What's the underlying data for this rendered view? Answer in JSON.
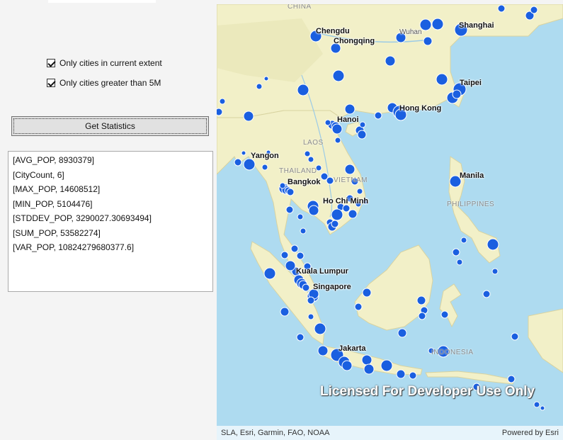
{
  "options": {
    "extent_label": "Only cities in current extent",
    "extent_checked": true,
    "pop_label": "Only cities greater than 5M",
    "pop_checked": true
  },
  "get_stats_label": "Get Statistics",
  "results": [
    "[AVG_POP, 8930379]",
    "[CityCount, 6]",
    "[MAX_POP, 14608512]",
    "[MIN_POP, 5104476]",
    "[STDDEV_POP, 3290027.30693494]",
    "[SUM_POP, 53582274]",
    "[VAR_POP, 10824279680377.6]"
  ],
  "map": {
    "cities": {
      "chengdu": "Chengdu",
      "chongqing": "Chongqing",
      "wuhan": "Wuhan",
      "shanghai": "Shanghai",
      "taipei": "Taipei",
      "hongkong": "Hong Kong",
      "hanoi": "Hanoi",
      "yangon": "Yangon",
      "bangkok": "Bangkok",
      "hochiminh": "Ho Chi Minh",
      "manila": "Manila",
      "kualalumpur": "Kuala Lumpur",
      "singapore": "Singapore",
      "jakarta": "Jakarta"
    },
    "countries": {
      "china": "CHINA",
      "laos": "LAOS",
      "thailand": "THAILAND",
      "vietnam": "VIETNAM",
      "philippines": "PHILIPPINES",
      "indonesia": "INDONESIA"
    },
    "watermark": "Licensed For Developer Use Only",
    "attribution": "SLA, Esri, Garmin, FAO, NOAA",
    "powered_by": "Powered by Esri",
    "colors": {
      "city_dot": "#1a5fe0",
      "land": "#f2f0c8",
      "water": "#aedbf0"
    }
  }
}
